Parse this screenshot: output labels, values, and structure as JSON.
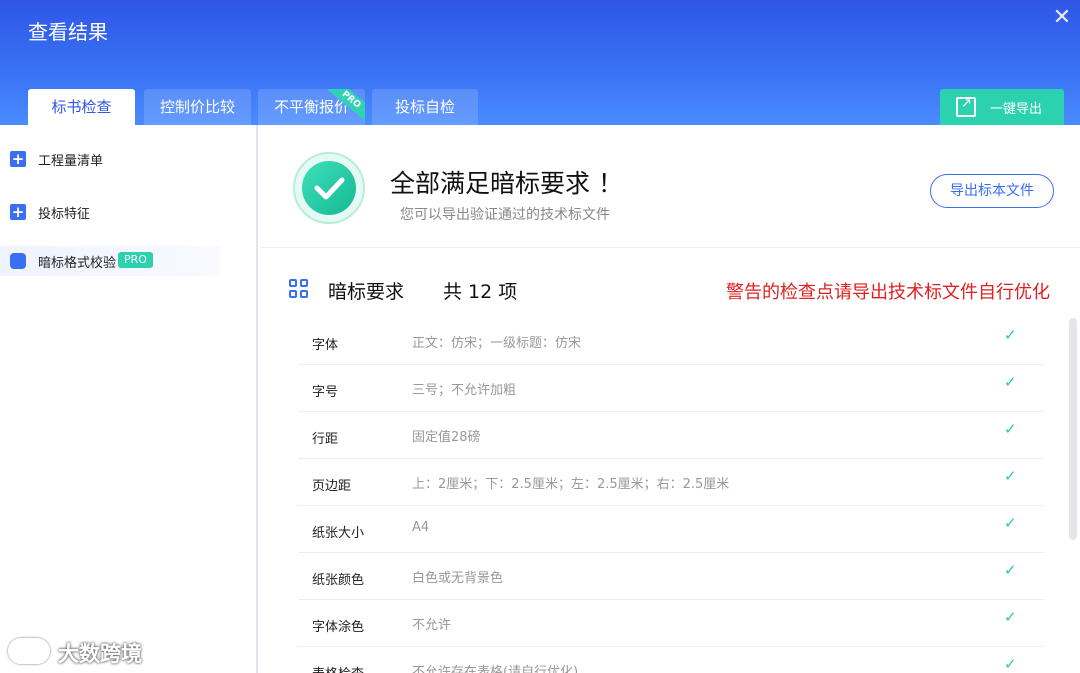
{
  "window": {
    "title": "查看结果",
    "close_icon": "close-icon"
  },
  "tabs": [
    {
      "label": "标书检查",
      "active": true
    },
    {
      "label": "控制价比较",
      "active": false
    },
    {
      "label": "不平衡报价",
      "active": false,
      "ribbon": "PRO"
    },
    {
      "label": "投标自检",
      "active": false
    }
  ],
  "export_all": {
    "label": "一键导出",
    "icon": "export-icon"
  },
  "sidebar": {
    "items": [
      {
        "label": "工程量清单",
        "icon": "plus-icon"
      },
      {
        "label": "投标特征",
        "icon": "plus-icon"
      },
      {
        "label": "暗标格式校验",
        "icon": "square-icon",
        "badge": "PRO",
        "active": true
      }
    ]
  },
  "result": {
    "title": "全部满足暗标要求 ！",
    "subtitle": "您可以导出验证通过的技术标文件",
    "export_button": "导出标本文件"
  },
  "requirements": {
    "title": "暗标要求",
    "count": "共 12 项",
    "warning": "警告的检查点请导出技术标文件自行优化",
    "rows": [
      {
        "name": "字体",
        "value": "正文：仿宋；一级标题：仿宋",
        "status": "✓"
      },
      {
        "name": "字号",
        "value": "三号；不允许加粗",
        "status": "✓"
      },
      {
        "name": "行距",
        "value": "固定值28磅",
        "status": "✓"
      },
      {
        "name": "页边距",
        "value": "上：2厘米；下：2.5厘米；左：2.5厘米；右：2.5厘米",
        "status": "✓"
      },
      {
        "name": "纸张大小",
        "value": "A4",
        "status": "✓"
      },
      {
        "name": "纸张颜色",
        "value": "白色或无背景色",
        "status": "✓"
      },
      {
        "name": "字体涂色",
        "value": "不允许",
        "status": "✓"
      },
      {
        "name": "表格检查",
        "value": "不允许存在表格(请自行优化)",
        "status": "✓"
      }
    ]
  },
  "watermark": {
    "text": "大数跨境"
  },
  "colors": {
    "header": "#3a6ff2",
    "accent": "#2cd1b0",
    "warning": "#e02020"
  }
}
